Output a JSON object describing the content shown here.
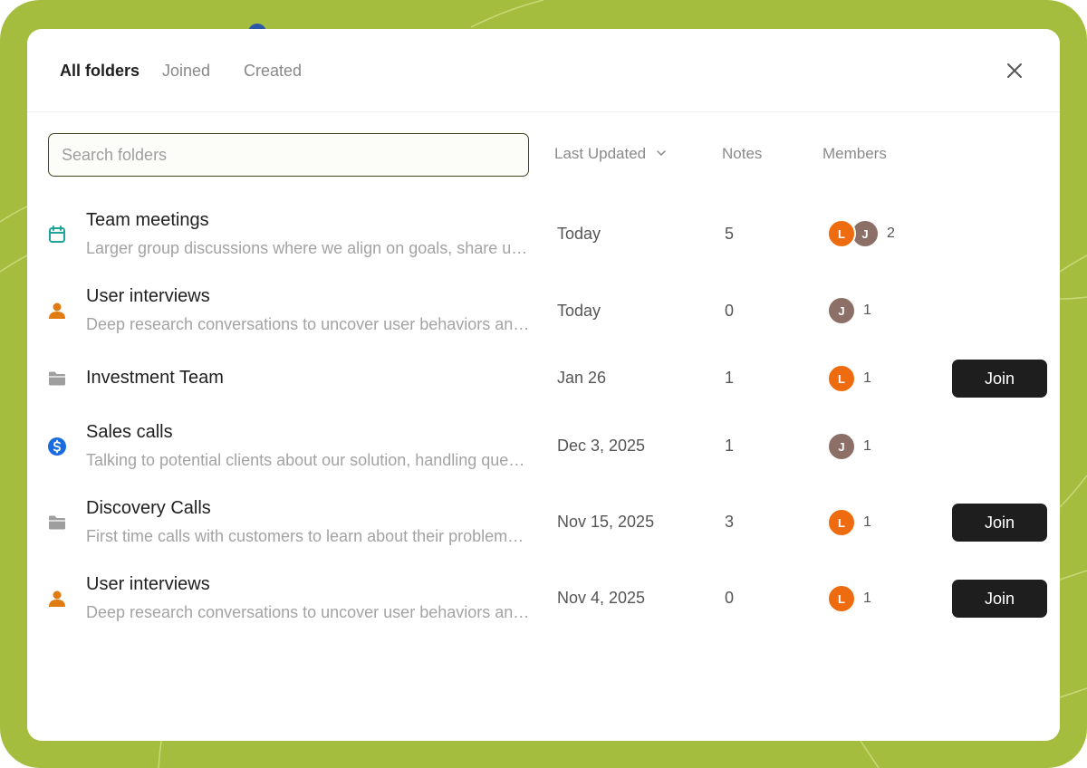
{
  "tabs": [
    {
      "label": "All folders",
      "active": true
    },
    {
      "label": "Joined",
      "active": false
    },
    {
      "label": "Created",
      "active": false
    }
  ],
  "search": {
    "placeholder": "Search folders",
    "value": ""
  },
  "columns": {
    "last_updated": "Last Updated",
    "notes": "Notes",
    "members": "Members"
  },
  "join_label": "Join",
  "colors": {
    "backdrop": "#a5bd3f",
    "avatar_l": "#ee6c0f",
    "avatar_j": "#8c6f66",
    "calendar_icon": "#1fa39a",
    "person_icon": "#e07b12",
    "folder_icon": "#9e9e9e",
    "dollar_icon": "#1b6be0"
  },
  "folders": [
    {
      "icon": "calendar-icon",
      "name": "Team meetings",
      "description": "Larger group discussions where we align on goals, share updates and plan upcoming work",
      "last_updated": "Today",
      "notes": "5",
      "members": [
        "L",
        "J"
      ],
      "member_count": "2",
      "joinable": false
    },
    {
      "icon": "person-icon",
      "name": "User interviews",
      "description": "Deep research conversations to uncover user behaviors and needs",
      "last_updated": "Today",
      "notes": "0",
      "members": [
        "J"
      ],
      "member_count": "1",
      "joinable": false
    },
    {
      "icon": "folder-icon",
      "name": "Investment Team",
      "description": "",
      "last_updated": "Jan 26",
      "notes": "1",
      "members": [
        "L"
      ],
      "member_count": "1",
      "joinable": true
    },
    {
      "icon": "dollar-icon",
      "name": "Sales calls",
      "description": "Talking to potential clients about our solution, handling questions and objections",
      "last_updated": "Dec 3, 2025",
      "notes": "1",
      "members": [
        "J"
      ],
      "member_count": "1",
      "joinable": false
    },
    {
      "icon": "folder-icon",
      "name": "Discovery Calls",
      "description": "First time calls with customers to learn about their problems and goals",
      "last_updated": "Nov 15, 2025",
      "notes": "3",
      "members": [
        "L"
      ],
      "member_count": "1",
      "joinable": true
    },
    {
      "icon": "person-icon",
      "name": "User interviews",
      "description": "Deep research conversations to uncover user behaviors and needs",
      "last_updated": "Nov 4, 2025",
      "notes": "0",
      "members": [
        "L"
      ],
      "member_count": "1",
      "joinable": true
    }
  ]
}
